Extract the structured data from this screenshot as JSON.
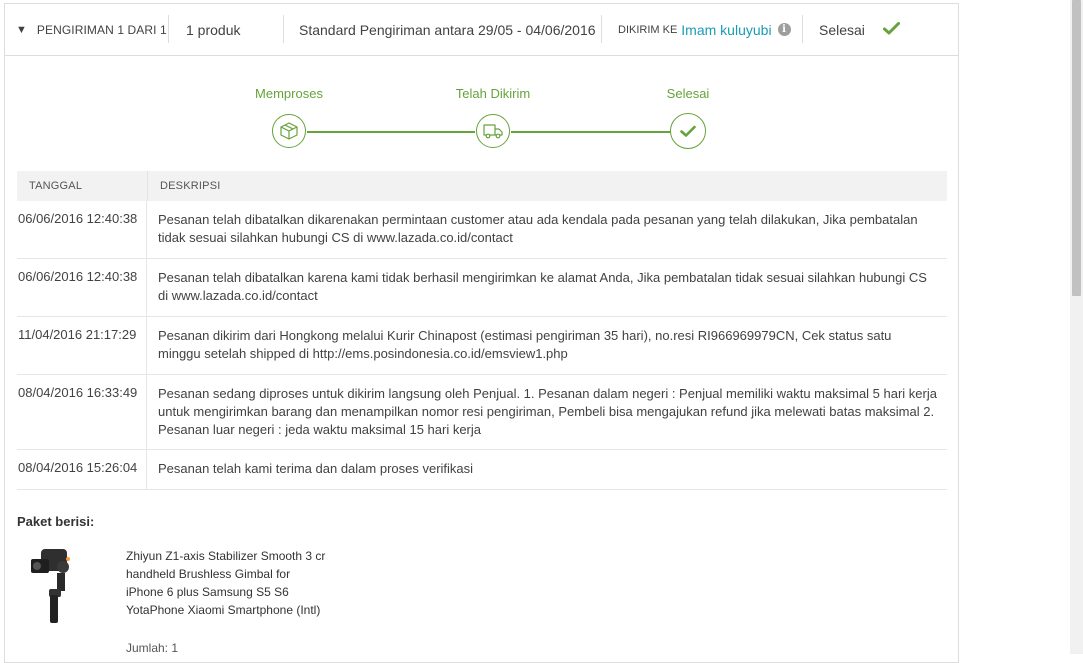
{
  "header": {
    "shipment_label": "PENGIRIMAN 1 DARI 1",
    "product_count": "1 produk",
    "shipping_info": "Standard Pengiriman antara 29/05 - 04/06/2016",
    "ship_to_label": "DIKIRIM KE",
    "recipient": "Imam kuluyubi",
    "info_glyph": "i",
    "status": "Selesai"
  },
  "tracker": {
    "steps": [
      {
        "label": "Memproses",
        "icon": "box-icon"
      },
      {
        "label": "Telah Dikirim",
        "icon": "truck-icon"
      },
      {
        "label": "Selesai",
        "icon": "check-icon"
      }
    ],
    "color": "#66a33a"
  },
  "table": {
    "headers": [
      "TANGGAL",
      "DESKRIPSI"
    ],
    "rows": [
      {
        "date": "06/06/2016 12:40:38",
        "desc": "Pesanan telah dibatalkan dikarenakan permintaan customer atau ada kendala pada pesanan yang telah dilakukan, Jika pembatalan tidak sesuai silahkan hubungi CS di www.lazada.co.id/contact"
      },
      {
        "date": "06/06/2016 12:40:38",
        "desc": "Pesanan telah dibatalkan karena kami tidak berhasil mengirimkan ke alamat Anda, Jika pembatalan tidak sesuai silahkan hubungi CS di www.lazada.co.id/contact"
      },
      {
        "date": "11/04/2016 21:17:29",
        "desc": "Pesanan dikirim dari Hongkong melalui Kurir Chinapost (estimasi pengiriman 35 hari), no.resi RI966969979CN, Cek status satu minggu setelah shipped di http://ems.posindonesia.co.id/emsview1.php"
      },
      {
        "date": "08/04/2016 16:33:49",
        "desc": "Pesanan sedang diproses untuk dikirim langsung oleh Penjual. 1. Pesanan dalam negeri : Penjual memiliki waktu maksimal 5 hari kerja untuk mengirimkan barang dan menampilkan nomor resi pengiriman, Pembeli bisa mengajukan refund jika melewati batas maksimal 2. Pesanan luar negeri : jeda waktu maksimal 15 hari kerja"
      },
      {
        "date": "08/04/2016 15:26:04",
        "desc": "Pesanan telah kami terima dan dalam proses verifikasi"
      }
    ]
  },
  "package": {
    "title": "Paket berisi:",
    "product_name": "Zhiyun Z1-axis Stabilizer Smooth 3 cr handheld Brushless Gimbal for iPhone 6 plus Samsung S5 S6 YotaPhone Xiaomi Smartphone (Intl)",
    "quantity": "Jumlah: 1"
  },
  "colors": {
    "accent_green": "#66a33a",
    "link_blue": "#1a9cb7"
  }
}
